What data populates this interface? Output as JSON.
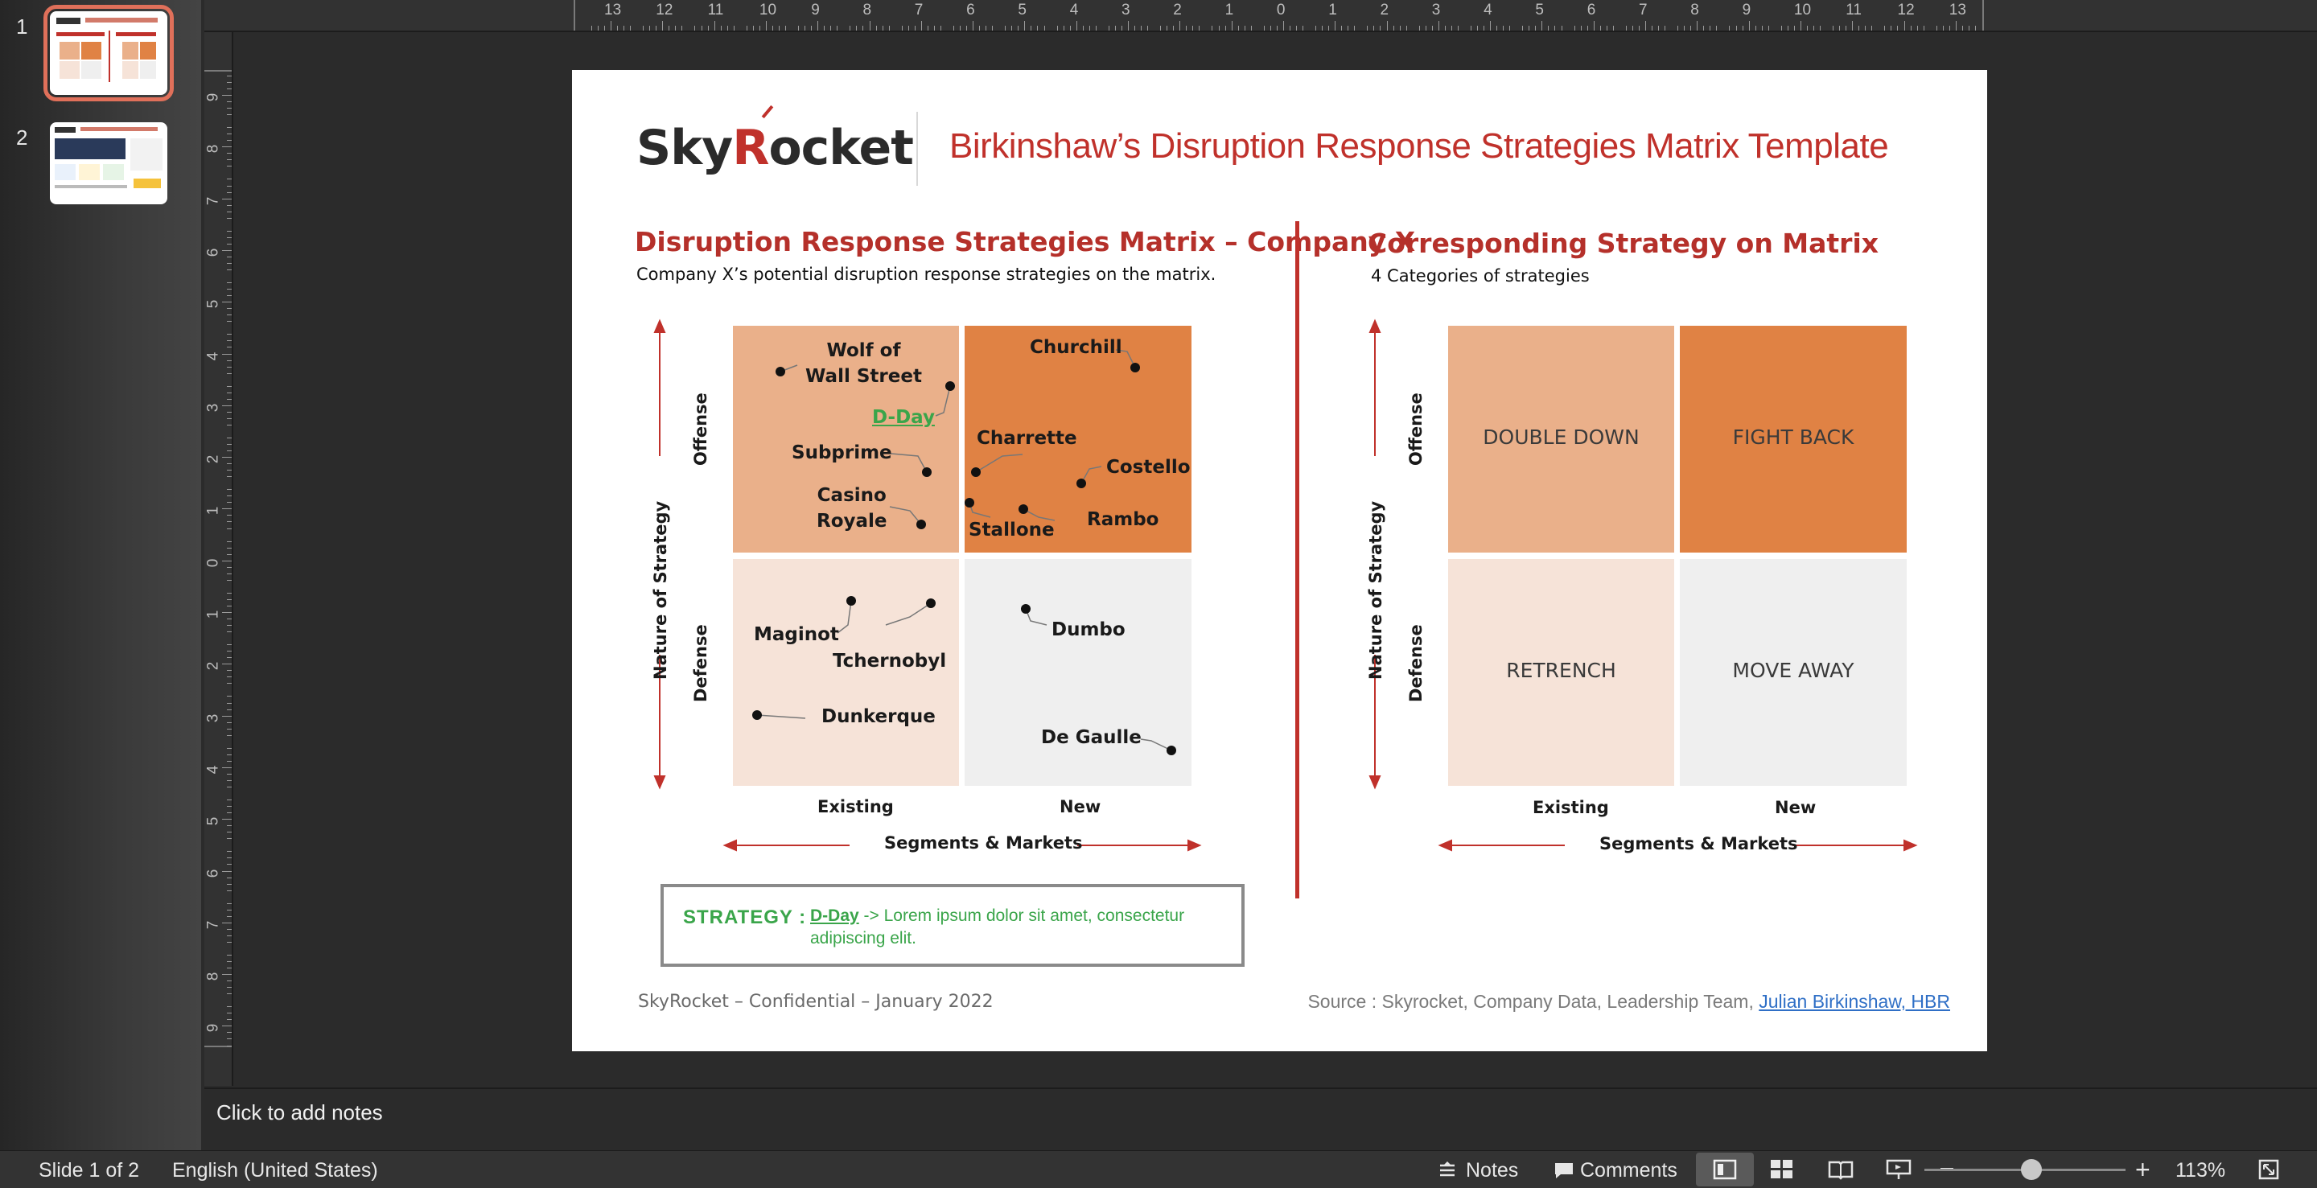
{
  "thumbnails": [
    {
      "number": "1",
      "selected": true
    },
    {
      "number": "2",
      "selected": false
    }
  ],
  "ruler": {
    "horizontal": [
      "13",
      "12",
      "11",
      "10",
      "9",
      "8",
      "7",
      "6",
      "5",
      "4",
      "3",
      "2",
      "1",
      "0",
      "1",
      "2",
      "3",
      "4",
      "5",
      "6",
      "7",
      "8",
      "9",
      "10",
      "11",
      "12",
      "13"
    ],
    "vertical": [
      "9",
      "8",
      "7",
      "6",
      "5",
      "4",
      "3",
      "2",
      "1",
      "0",
      "1",
      "2",
      "3",
      "4",
      "5",
      "6",
      "7",
      "8",
      "9"
    ]
  },
  "slide": {
    "logo": {
      "text_a": "Sky",
      "text_b": "R",
      "text_c": "ocket"
    },
    "title": "Birkinshaw’s Disruption Response Strategies Matrix Template",
    "left": {
      "heading": "Disruption Response Strategies Matrix – Company X",
      "subheading": "Company X’s  potential disruption response strategies on the matrix.",
      "y_axis": "Nature of Strategy",
      "y_top": "Offense",
      "y_bottom": "Defense",
      "x_axis": "Segments & Markets",
      "x_left": "Existing",
      "x_right": "New",
      "points": [
        {
          "label": "Wolf of\nWall Street"
        },
        {
          "label": "D-Day"
        },
        {
          "label": "Subprime"
        },
        {
          "label": "Casino\nRoyale"
        },
        {
          "label": "Churchill"
        },
        {
          "label": "Charrette"
        },
        {
          "label": "Costello"
        },
        {
          "label": "Stallone"
        },
        {
          "label": "Rambo"
        },
        {
          "label": "Maginot"
        },
        {
          "label": "Tchernobyl"
        },
        {
          "label": "Dunkerque"
        },
        {
          "label": "Dumbo"
        },
        {
          "label": "De Gaulle"
        }
      ],
      "strategy_box": {
        "label": "STRATEGY :",
        "link": "D-Day",
        "text": " -> Lorem ipsum dolor sit amet, consectetur adipiscing elit."
      }
    },
    "right": {
      "heading": "Corresponding Strategy on Matrix",
      "subheading": "4 Categories of strategies",
      "y_axis": "Nature of Strategy",
      "y_top": "Offense",
      "y_bottom": "Defense",
      "x_axis": "Segments & Markets",
      "x_left": "Existing",
      "x_right": "New",
      "quadrants": {
        "top_left": "DOUBLE DOWN",
        "top_right": "FIGHT BACK",
        "bottom_left": "RETRENCH",
        "bottom_right": "MOVE AWAY"
      }
    },
    "footer_left": "SkyRocket – Confidential – January 2022",
    "footer_source": "Source : Skyrocket, Company Data, Leadership Team, ",
    "footer_link": "Julian Birkinshaw, HBR"
  },
  "notes": {
    "placeholder": "Click to add notes"
  },
  "status": {
    "slide_info": "Slide 1 of 2",
    "language": "English (United States)",
    "notes_btn": "Notes",
    "comments_btn": "Comments",
    "zoom": "113%",
    "zoom_level_percent": 113
  },
  "colors": {
    "q_top_left": "#eab08a",
    "q_top_right": "#e08244",
    "q_bottom_left": "#f6e3d8",
    "q_bottom_right": "#efefef",
    "accent_red": "#c0312b",
    "strategy_green": "#3aa54a"
  }
}
